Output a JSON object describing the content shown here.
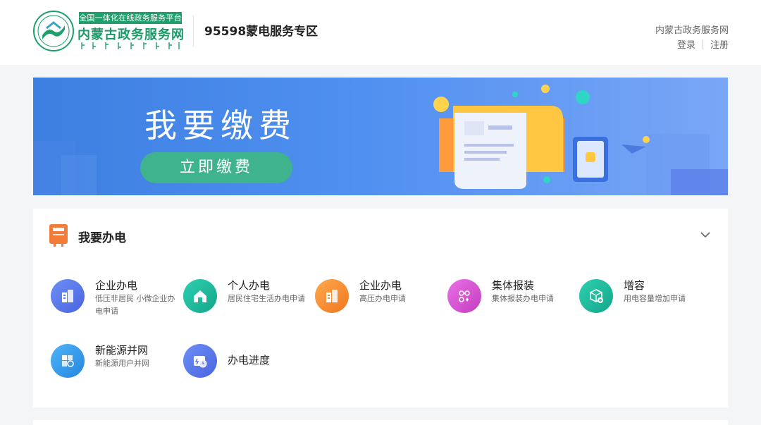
{
  "header": {
    "platform_tag": "全国一体化在线政务服务平台",
    "platform_name": "内蒙古政务服务网",
    "zone_title": "95598蒙电服务专区",
    "site_link": "内蒙古政务服务网",
    "login": "登录",
    "register": "注册"
  },
  "banner": {
    "title": "我要缴费",
    "button": "立即缴费"
  },
  "panel": {
    "title": "我要办电",
    "services": [
      {
        "name": "企业办电",
        "desc": "低压非居民 小微企业办电申请",
        "icon": "building-icon",
        "color": "#5b7cf0"
      },
      {
        "name": "个人办电",
        "desc": "居民住宅生活办电申请",
        "icon": "home-icon",
        "color": "#1fb89a"
      },
      {
        "name": "企业办电",
        "desc": "高压办电申请",
        "icon": "building-icon",
        "color": "#f58b2b"
      },
      {
        "name": "集体报装",
        "desc": "集体报装办电申请",
        "icon": "group-icon",
        "color": "#d955d6"
      },
      {
        "name": "增容",
        "desc": "用电容量增加申请",
        "icon": "cube-plus-icon",
        "color": "#1fb89a"
      },
      {
        "name": "新能源并网",
        "desc": "新能源用户并网",
        "icon": "solar-panel-icon",
        "color": "#3d9cf0"
      },
      {
        "name": "办电进度",
        "desc": "",
        "icon": "progress-icon",
        "color": "#5b7cf0"
      }
    ]
  }
}
